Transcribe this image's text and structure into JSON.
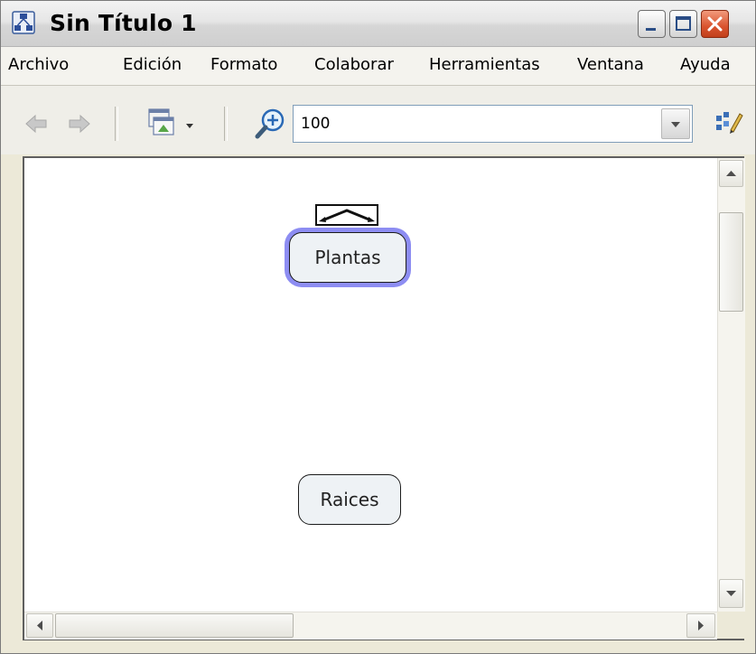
{
  "window": {
    "title": "Sin Título 1",
    "icons": [
      "concept-map-app-icon",
      "minimize-icon",
      "maximize-icon",
      "close-icon"
    ]
  },
  "menu": {
    "items": [
      "Archivo",
      "Edición",
      "Formato",
      "Colaborar",
      "Herramientas",
      "Ventana",
      "Ayuda"
    ]
  },
  "toolbar": {
    "icons": [
      "back-arrow-icon",
      "forward-arrow-icon",
      "view-menu-icon",
      "zoom-in-icon",
      "style-palette-icon"
    ],
    "zoom_value": "100"
  },
  "map": {
    "concepts": [
      {
        "label": "Plantas",
        "selected": true
      },
      {
        "label": "Raices",
        "selected": false
      }
    ],
    "selection_color": "#8d8df2"
  }
}
